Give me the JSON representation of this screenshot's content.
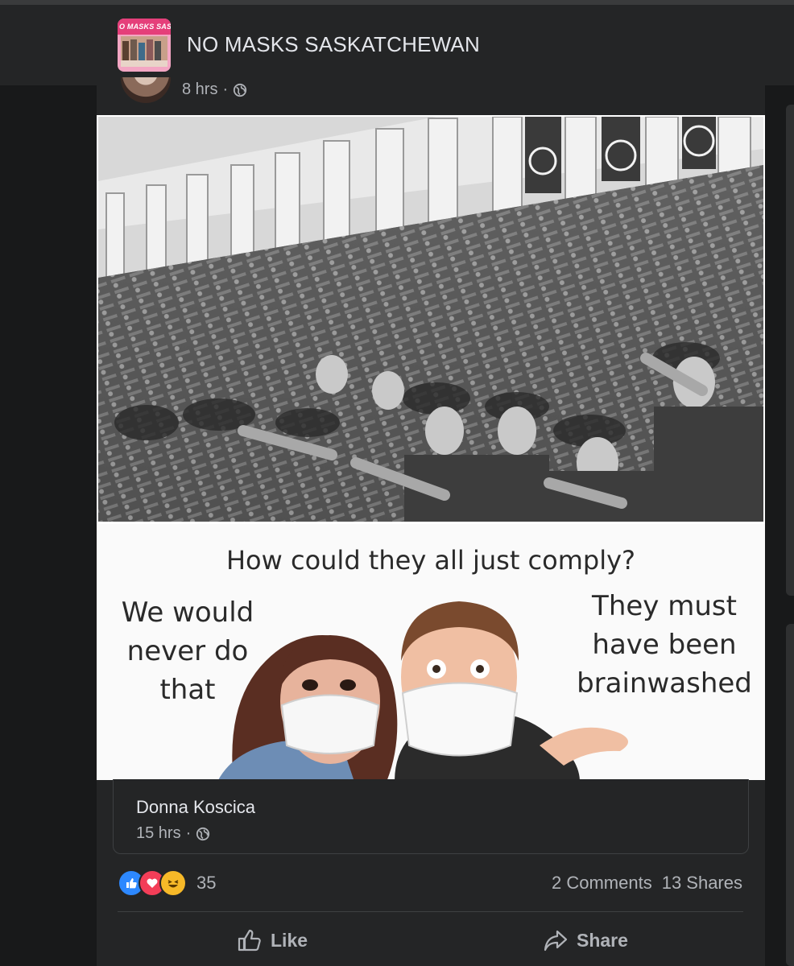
{
  "header": {
    "group_name": "NO MASKS SASKATCHEWAN",
    "thumb_text": "O MASKS SASI"
  },
  "post": {
    "time": "8 hrs",
    "separator": "·"
  },
  "meme": {
    "question": "How could they all just comply?",
    "left_text": [
      "We would",
      "never do",
      "that"
    ],
    "right_text": [
      "They must",
      "have been",
      "brainwashed"
    ]
  },
  "shared": {
    "author": "Donna Koscica",
    "time": "15 hrs",
    "separator": "·"
  },
  "engagement": {
    "reaction_count": "35",
    "comments": "2 Comments",
    "shares": "13 Shares"
  },
  "actions": {
    "like": "Like",
    "share": "Share"
  }
}
